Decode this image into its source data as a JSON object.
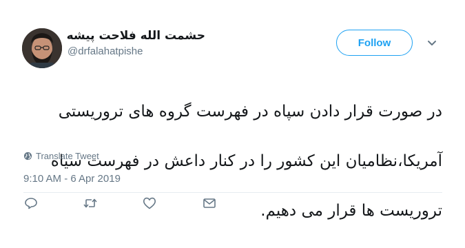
{
  "author": {
    "display_name": "حشمت الله فلاحت پیشه",
    "handle": "@drfalahatpishe"
  },
  "follow_button": {
    "label": "Follow"
  },
  "tweet": {
    "text_lines": [
      "در صورت قرار دادن سپاه در فهرست گروه های تروریستی",
      "آمریکا،نظامیان این کشور را در کنار داعش در فهرست سیاه",
      "تروریست ها قرار می دهیم."
    ],
    "translate_label": "Translate Tweet",
    "timestamp": "9:10 AM - 6 Apr 2019"
  },
  "actions": {
    "icons": [
      "reply-icon",
      "retweet-icon",
      "like-icon",
      "direct-message-icon"
    ]
  },
  "colors": {
    "accent": "#1da1f2",
    "secondary_text": "#657786",
    "primary_text": "#14171a",
    "divider": "#e6ecf0"
  }
}
